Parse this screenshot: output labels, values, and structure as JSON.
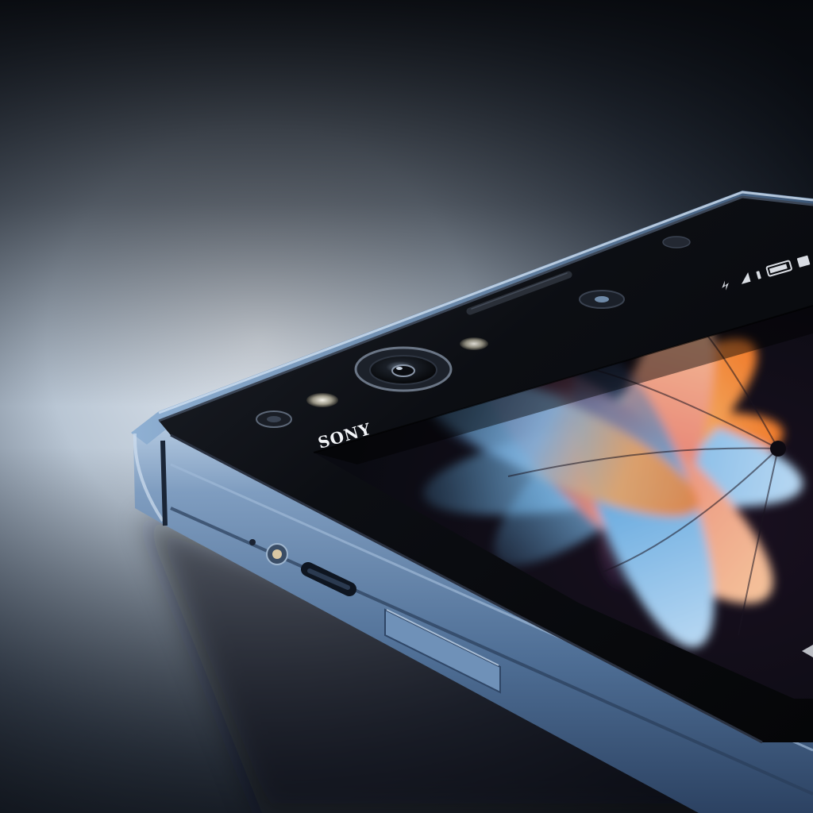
{
  "photo": {
    "subject": "smartphone",
    "brand_text": "SONY"
  },
  "colors": {
    "background_light": "#c9d3de",
    "background_dark": "#0d1118",
    "frame_blue": "#5a7ca6",
    "frame_highlight": "#a9c2de",
    "glass_black": "#0a0c10",
    "wallpaper_orange": "#f08a3a",
    "wallpaper_blue": "#6aa8d8",
    "wallpaper_purple": "#6e4a8a"
  },
  "icons": [
    "front-camera-icon",
    "proximity-sensor-icon",
    "earpiece-icon",
    "status-bar-icons",
    "usb-port-icon",
    "microphone-icon",
    "volume-button"
  ]
}
